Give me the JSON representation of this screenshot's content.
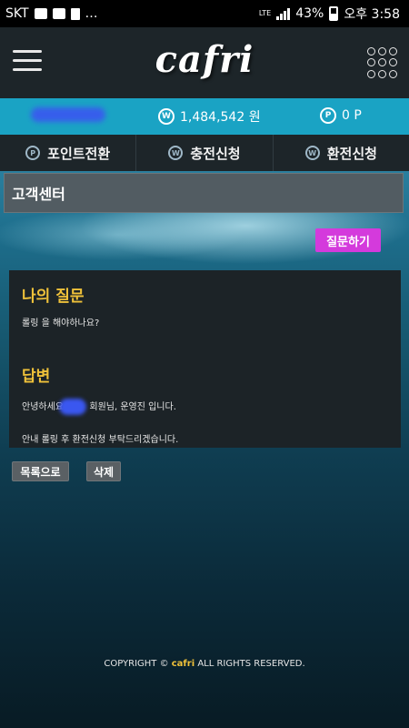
{
  "status_bar": {
    "carrier": "SKT",
    "more": "…",
    "network": "LTE",
    "battery": "43%",
    "time": "오후 3:58"
  },
  "header": {
    "logo": "cafri"
  },
  "account": {
    "balance": "1,484,542 원",
    "balance_icon": "W",
    "points": "0 P",
    "points_icon": "P"
  },
  "menu": {
    "items": [
      {
        "label": "포인트전환",
        "icon": "P"
      },
      {
        "label": "충전신청",
        "icon": "W"
      },
      {
        "label": "환전신청",
        "icon": "W"
      }
    ]
  },
  "page": {
    "title": "고객센터",
    "ask_button": "질문하기"
  },
  "qa": {
    "question_heading": "나의 질문",
    "question_text": "롤링 을 해야하나요?",
    "answer_heading": "답변",
    "answer_line1_prefix": "안녕하세요",
    "answer_line1_suffix": "회원님, 운영진 입니다.",
    "answer_line2": "안내 롤링 후 환전신청 부탁드리겠습니다."
  },
  "actions": {
    "list_button": "목록으로",
    "delete_button": "삭제"
  },
  "footer": {
    "prefix": "COPYRIGHT © ",
    "brand": "cafri",
    "suffix": " ALL RIGHTS RESERVED."
  }
}
